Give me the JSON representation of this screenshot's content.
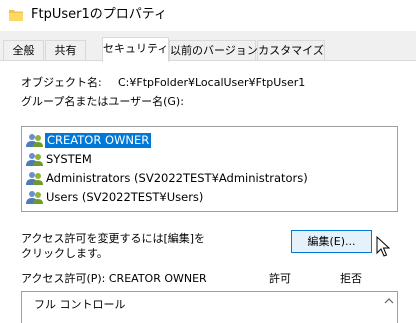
{
  "window": {
    "title": "FtpUser1のプロパティ",
    "icon": "folder-icon"
  },
  "tabs": [
    {
      "label": "全般",
      "active": false
    },
    {
      "label": "共有",
      "active": false
    },
    {
      "label": "セキュリティ",
      "active": true
    },
    {
      "label": "以前のバージョン",
      "active": false
    },
    {
      "label": "カスタマイズ",
      "active": false
    }
  ],
  "security": {
    "object_name_label": "オブジェクト名:",
    "object_name_value": "C:¥FtpFolder¥LocalUser¥FtpUser1",
    "group_label": "グループ名またはユーザー名(G):",
    "principals": [
      {
        "name": "CREATOR OWNER",
        "icon": "users-icon",
        "selected": true
      },
      {
        "name": "SYSTEM",
        "icon": "users-icon",
        "selected": false
      },
      {
        "name": "Administrators (SV2022TEST¥Administrators)",
        "icon": "users-icon",
        "selected": false
      },
      {
        "name": "Users (SV2022TEST¥Users)",
        "icon": "users-icon",
        "selected": false
      }
    ],
    "change_hint_line1": "アクセス許可を変更するには[編集]を",
    "change_hint_line2": "クリックします。",
    "edit_button": "編集(E)...",
    "permissions_label": "アクセス許可(P): CREATOR OWNER",
    "allow_header": "許可",
    "deny_header": "拒否",
    "permissions": [
      {
        "name": "フル コントロール"
      }
    ]
  },
  "colors": {
    "selection": "#0078d7",
    "button_bg": "#e5f1fb",
    "tab_bg": "#f0f0f0"
  }
}
